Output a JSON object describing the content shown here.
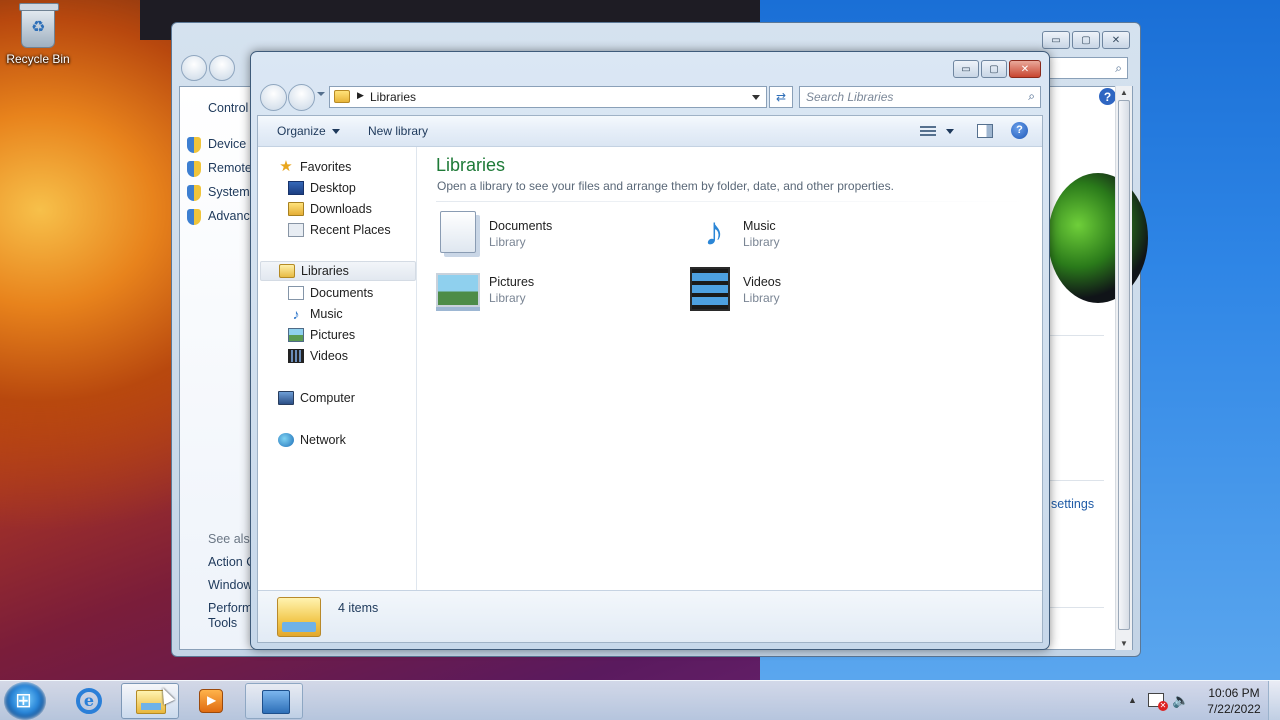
{
  "desktop": {
    "recycle_bin_label": "Recycle Bin"
  },
  "back_window": {
    "header_item": "Control",
    "left_items": [
      {
        "label": "Device M",
        "icon": "shield-icon"
      },
      {
        "label": "Remote",
        "icon": "shield-icon"
      },
      {
        "label": "System",
        "icon": "shield-icon"
      },
      {
        "label": "Advance",
        "icon": "shield-icon"
      }
    ],
    "see_also_heading": "See also",
    "see_also_items": [
      "Action C",
      "Window",
      "Perform",
      "Tools"
    ],
    "right_link": "settings",
    "caption": {
      "minimize": "▭",
      "maximize": "▢",
      "close": "✕"
    }
  },
  "explorer": {
    "caption": {
      "minimize": "▭",
      "maximize": "▢",
      "close": "✕"
    },
    "address": {
      "breadcrumb": "Libraries",
      "separator": "▶"
    },
    "search": {
      "placeholder": "Search Libraries",
      "value": ""
    },
    "toolbar": {
      "organize_label": "Organize",
      "new_library_label": "New library",
      "help_label": "?"
    },
    "nav_pane": {
      "favorites": {
        "label": "Favorites",
        "icon": "star-icon"
      },
      "favorite_items": [
        {
          "label": "Desktop",
          "icon": "desktop-icon"
        },
        {
          "label": "Downloads",
          "icon": "downloads-folder-icon"
        },
        {
          "label": "Recent Places",
          "icon": "recent-places-icon"
        }
      ],
      "libraries": {
        "label": "Libraries",
        "icon": "libraries-icon"
      },
      "library_items": [
        {
          "label": "Documents",
          "icon": "documents-icon"
        },
        {
          "label": "Music",
          "icon": "music-icon"
        },
        {
          "label": "Pictures",
          "icon": "pictures-icon"
        },
        {
          "label": "Videos",
          "icon": "videos-icon"
        }
      ],
      "computer": {
        "label": "Computer",
        "icon": "computer-icon"
      },
      "network": {
        "label": "Network",
        "icon": "network-icon"
      }
    },
    "content": {
      "title": "Libraries",
      "subtitle": "Open a library to see your files and arrange them by folder, date, and other properties.",
      "libraries": [
        {
          "name": "Documents",
          "kind": "Library",
          "icon": "documents-library-icon"
        },
        {
          "name": "Music",
          "kind": "Library",
          "icon": "music-library-icon"
        },
        {
          "name": "Pictures",
          "kind": "Library",
          "icon": "pictures-library-icon"
        },
        {
          "name": "Videos",
          "kind": "Library",
          "icon": "videos-library-icon"
        }
      ]
    },
    "details": {
      "item_count": "4 items"
    }
  },
  "taskbar": {
    "apps": [
      {
        "name": "Internet Explorer",
        "icon": "internet-explorer-icon"
      },
      {
        "name": "Windows Explorer",
        "icon": "windows-explorer-icon"
      },
      {
        "name": "Windows Media Player",
        "icon": "media-player-icon"
      },
      {
        "name": "Control Panel",
        "icon": "control-panel-icon"
      }
    ],
    "clock": {
      "time": "10:06 PM",
      "date": "7/22/2022"
    },
    "ie_glyph": "e"
  },
  "colors": {
    "title_green": "#1e7a37",
    "link_blue": "#1f5ba6",
    "close_red": "#c8452f"
  }
}
